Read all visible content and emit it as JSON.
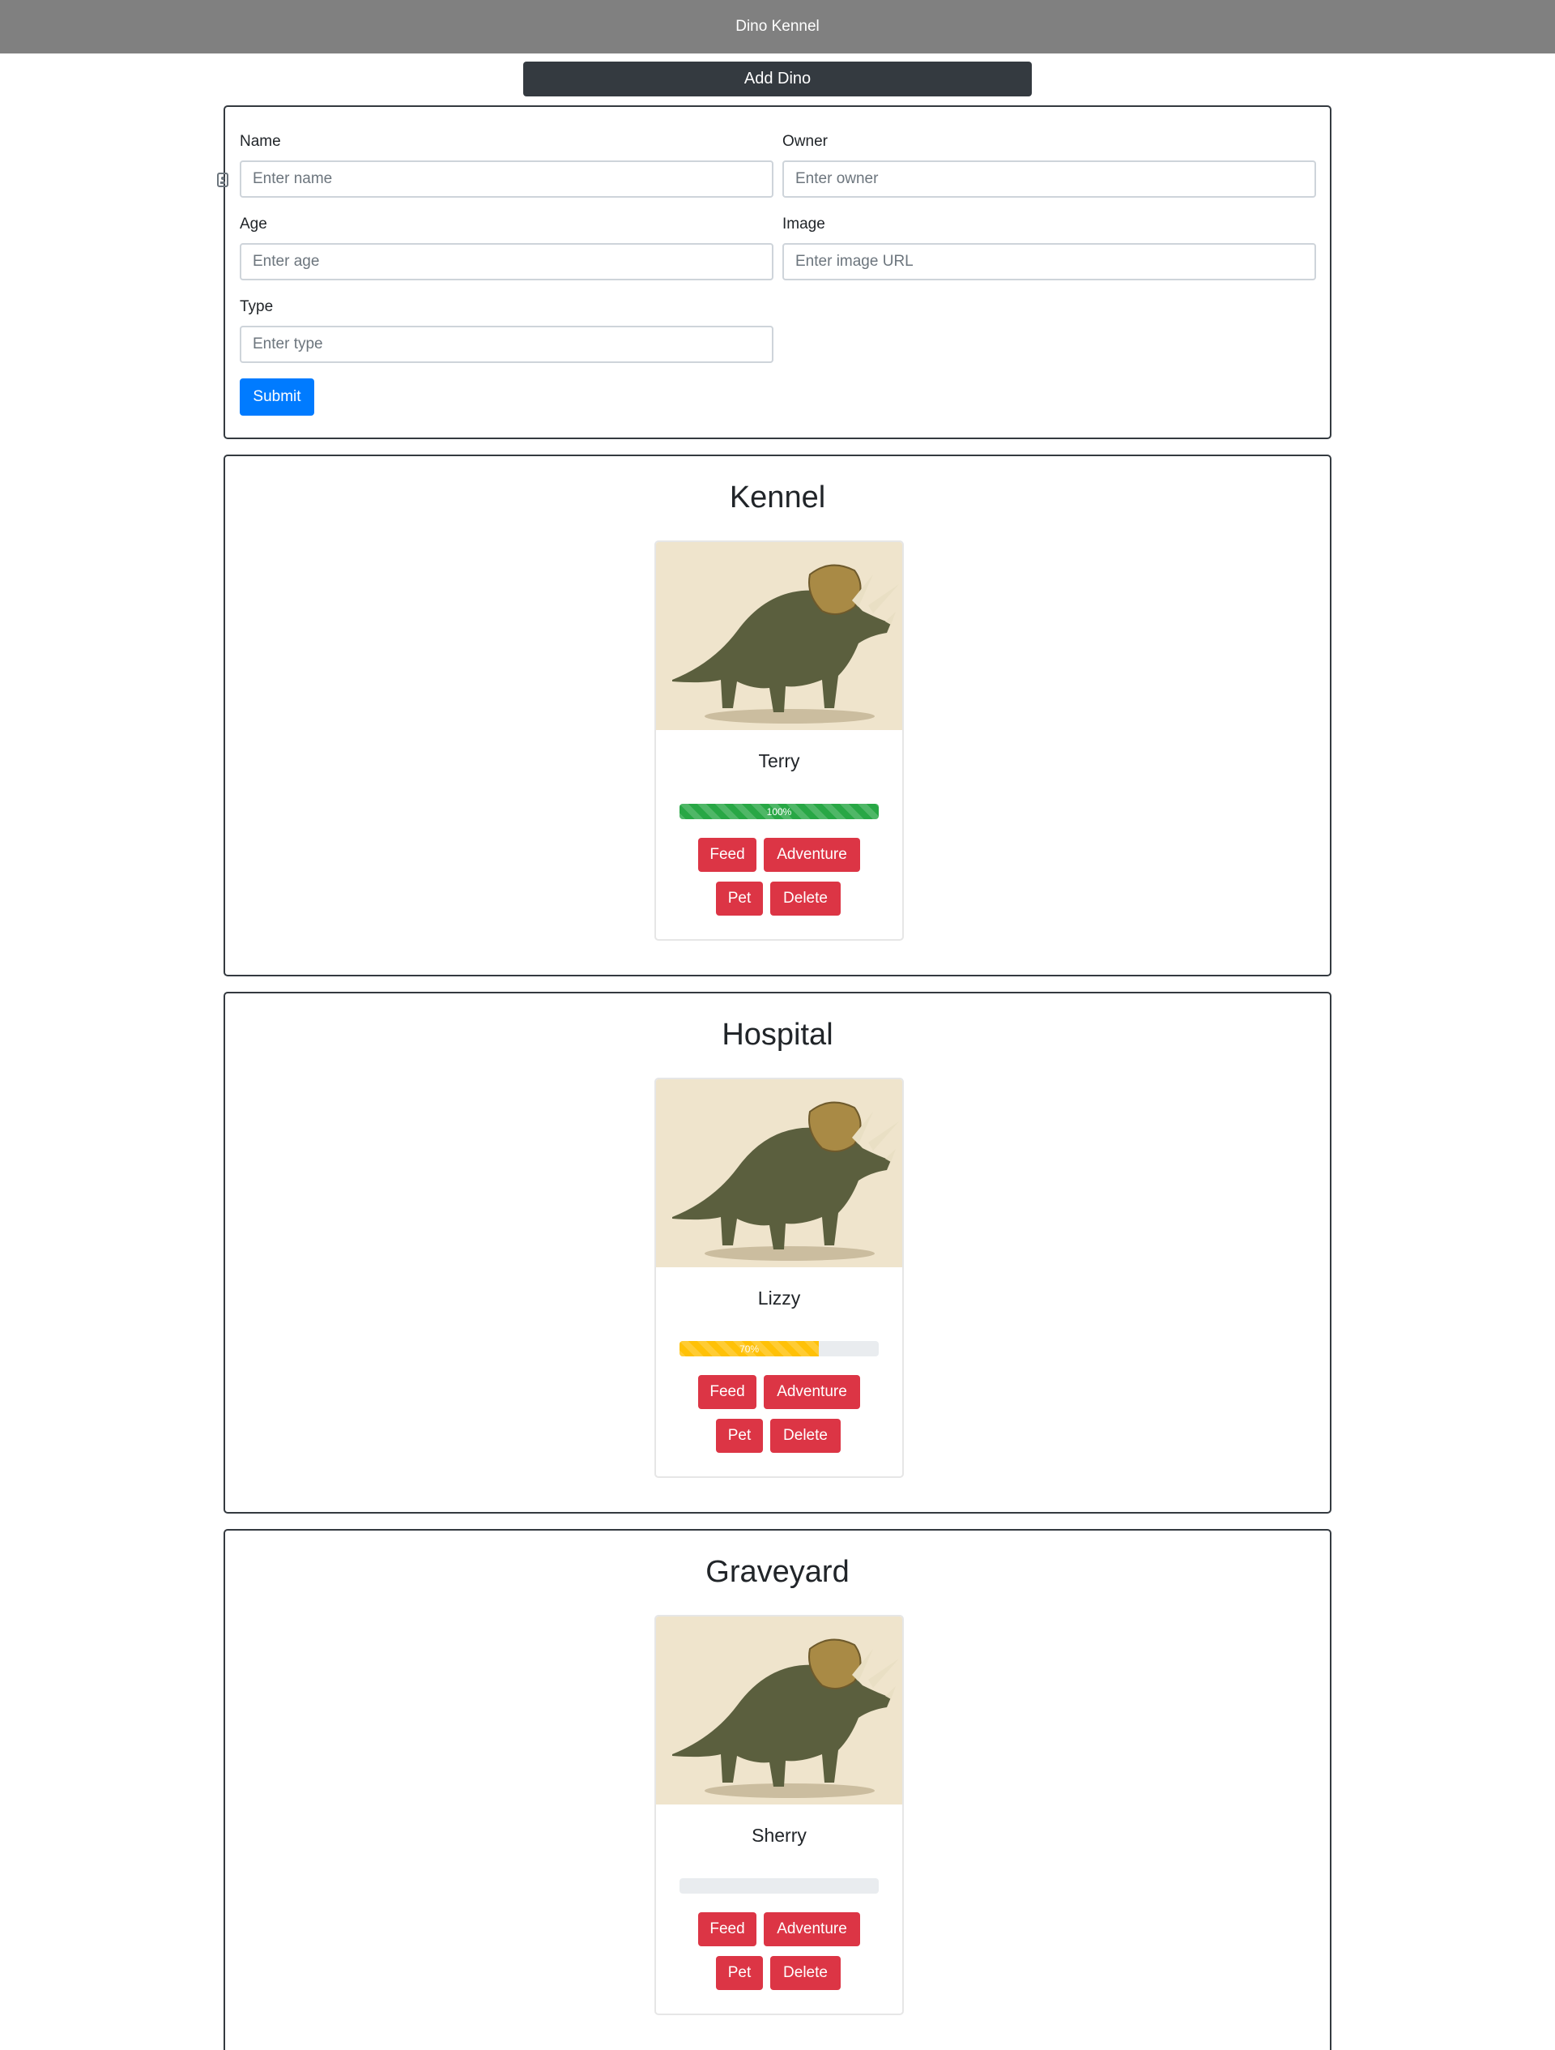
{
  "navbar": {
    "title": "Dino Kennel"
  },
  "add_dino_button": {
    "label": "Add Dino"
  },
  "form": {
    "name": {
      "label": "Name",
      "placeholder": "Enter name",
      "value": ""
    },
    "owner": {
      "label": "Owner",
      "placeholder": "Enter owner",
      "value": ""
    },
    "age": {
      "label": "Age",
      "placeholder": "Enter age",
      "value": ""
    },
    "image": {
      "label": "Image",
      "placeholder": "Enter image URL",
      "value": ""
    },
    "type": {
      "label": "Type",
      "placeholder": "Enter type",
      "value": ""
    },
    "submit_label": "Submit"
  },
  "sections": [
    {
      "title": "Kennel",
      "dino": {
        "name": "Terry",
        "health_percent": 100,
        "health_label": "100%",
        "bar_color": "#28a745",
        "buttons": {
          "feed": "Feed",
          "adventure": "Adventure",
          "pet": "Pet",
          "delete": "Delete"
        }
      }
    },
    {
      "title": "Hospital",
      "dino": {
        "name": "Lizzy",
        "health_percent": 70,
        "health_label": "70%",
        "bar_color": "#ffc107",
        "buttons": {
          "feed": "Feed",
          "adventure": "Adventure",
          "pet": "Pet",
          "delete": "Delete"
        }
      }
    },
    {
      "title": "Graveyard",
      "dino": {
        "name": "Sherry",
        "health_percent": 0,
        "health_label": "",
        "bar_color": "#dc3545",
        "buttons": {
          "feed": "Feed",
          "adventure": "Adventure",
          "pet": "Pet",
          "delete": "Delete"
        }
      }
    }
  ],
  "colors": {
    "navbar": "#808080",
    "dark_button": "#343a40",
    "primary": "#007bff",
    "danger": "#dc3545",
    "success": "#28a745",
    "warning": "#ffc107"
  }
}
